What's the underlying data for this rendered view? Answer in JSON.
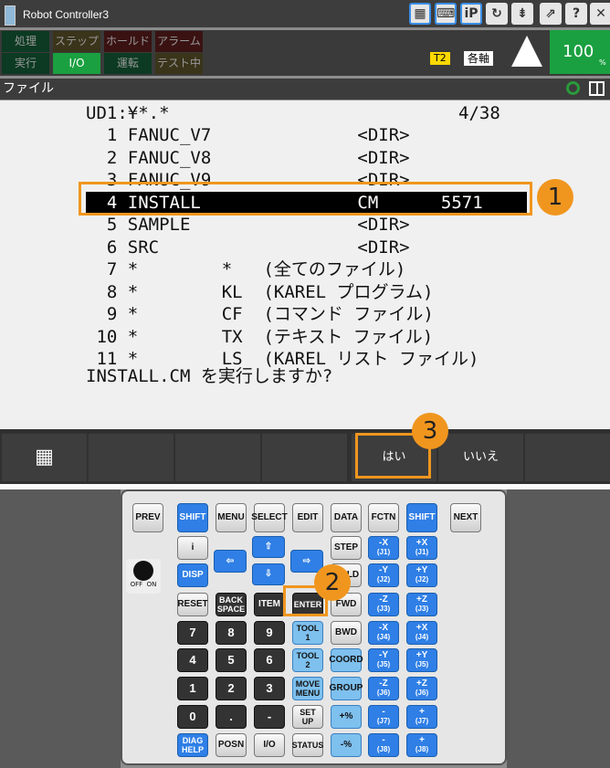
{
  "window": {
    "title": "Robot Controller3",
    "toolbar": [
      "▦",
      "⌨",
      "iP",
      "↻",
      "⇟",
      "⇗",
      "?",
      "✕"
    ]
  },
  "status": {
    "row1": [
      "処理",
      "ステップ",
      "ホールド",
      "アラーム"
    ],
    "row2": [
      "実行",
      "I/O",
      "運転",
      "テスト中"
    ],
    "mode": "T2",
    "coord": "各軸",
    "override": "100",
    "override_unit": "%"
  },
  "header": {
    "title": "ファイル"
  },
  "screen": {
    "path": "UD1:¥*.*",
    "page": "4/38",
    "lines": [
      "  1 FANUC_V7              <DIR>",
      "  2 FANUC_V8              <DIR>",
      "  3 FANUC_V9              <DIR>",
      "  4 INSTALL               CM      5571",
      "  5 SAMPLE                <DIR>",
      "  6 SRC                   <DIR>",
      "  7 *        *   (全てのファイル)",
      "  8 *        KL  (KAREL プログラム)",
      "  9 *        CF  (コマンド ファイル)",
      " 10 *        TX  (テキスト ファイル)",
      " 11 *        LS  (KAREL リスト ファイル)"
    ],
    "selected": 3,
    "prompt": "INSTALL.CM を実行しますか?"
  },
  "fkeys": {
    "yes": "はい",
    "no": "いいえ"
  },
  "callouts": [
    "1",
    "2",
    "3"
  ],
  "keys": {
    "top": [
      "PREV",
      "SHIFT",
      "MENU",
      "SELECT",
      "EDIT",
      "DATA",
      "FCTN",
      "SHIFT",
      "NEXT"
    ],
    "info": "i",
    "disp": "DISP",
    "reset": "RESET",
    "back": "BACK SPACE",
    "item": "ITEM",
    "enter": "ENTER",
    "step": "STEP",
    "hold": "HOLD",
    "fwd": "FWD",
    "bwd": "BWD",
    "coord": "COORD",
    "group": "GROUP",
    "plus_pct": "+%",
    "minus_pct": "-%",
    "digits": [
      "7",
      "8",
      "9",
      "4",
      "5",
      "6",
      "1",
      "2",
      "3",
      "0",
      "."
    ],
    "minus": "-",
    "tool1": "TOOL 1",
    "tool2": "TOOL 2",
    "move": "MOVE MENU",
    "setup": "SET UP",
    "status": "STATUS",
    "diag": "DIAG HELP",
    "posn": "POSN",
    "io": "I/O",
    "jog": [
      [
        "-X",
        "(J1)",
        "+X",
        "(J1)"
      ],
      [
        "-Y",
        "(J2)",
        "+Y",
        "(J2)"
      ],
      [
        "-Z",
        "(J3)",
        "+Z",
        "(J3)"
      ],
      [
        "-X",
        "(J4)",
        "+X",
        "(J4)"
      ],
      [
        "-Y",
        "(J5)",
        "+Y",
        "(J5)"
      ],
      [
        "-Z",
        "(J6)",
        "+Z",
        "(J6)"
      ],
      [
        "-",
        "(J7)",
        "+",
        "(J7)"
      ],
      [
        "-",
        "(J8)",
        "+",
        "(J8)"
      ]
    ],
    "switch": "OFF  ON"
  }
}
